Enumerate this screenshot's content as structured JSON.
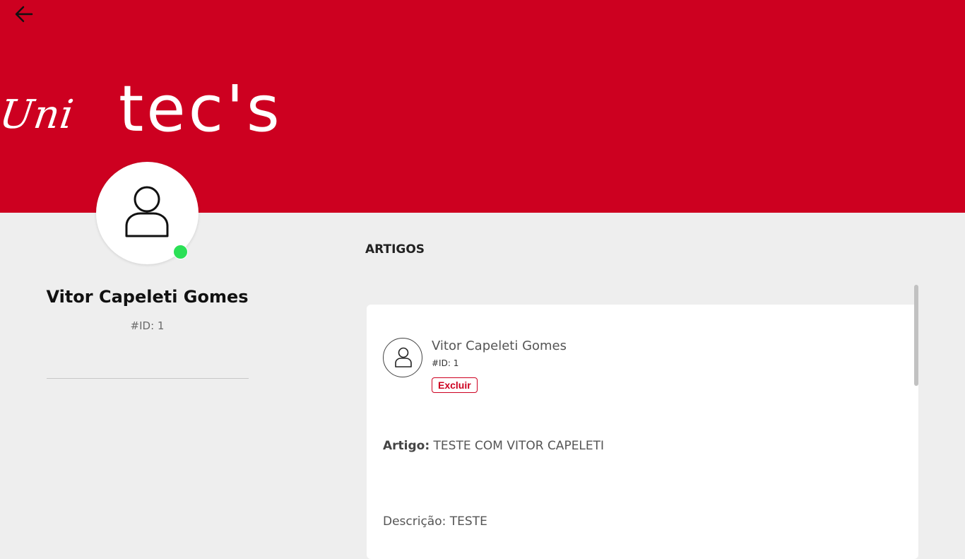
{
  "header": {
    "back_icon": "arrow-left-icon",
    "logo_part1": "Uni",
    "logo_part2": "tec's",
    "brand_color": "#cd0020"
  },
  "profile": {
    "avatar_icon": "user-icon",
    "status_color": "#2be056",
    "name": "Vitor Capeleti Gomes",
    "id_label": "#ID: 1"
  },
  "articles": {
    "section_title": "ARTIGOS",
    "items": [
      {
        "avatar_icon": "user-icon",
        "author": "Vitor Capeleti Gomes",
        "id_label": "#ID: 1",
        "delete_label": "Excluir",
        "article_label": "Artigo:",
        "article_title": "TESTE COM VITOR CAPELETI",
        "description": "Descrição: TESTE"
      }
    ]
  }
}
